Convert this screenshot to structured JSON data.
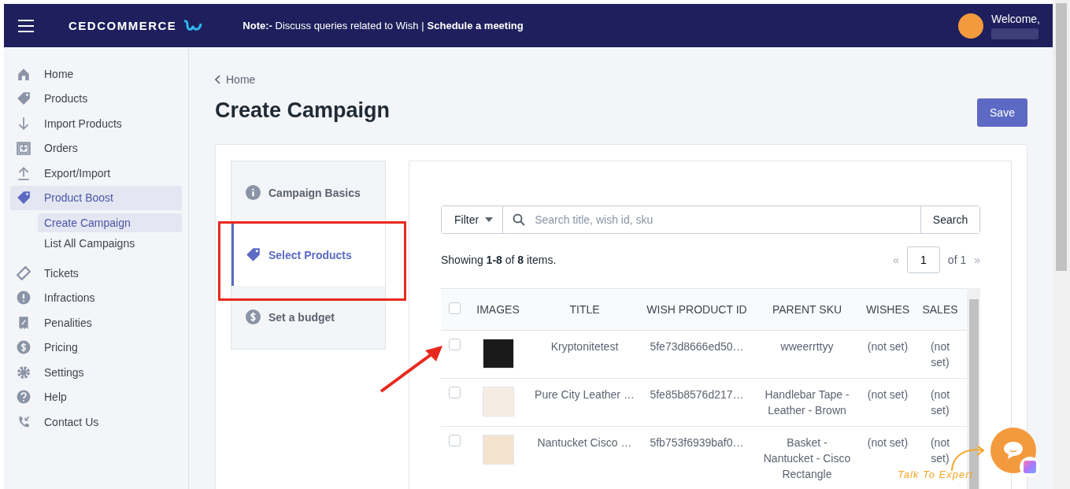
{
  "header": {
    "brand": "CEDCOMMERCE",
    "note_label": "Note:-",
    "note_text": "Discuss queries related to Wish |",
    "note_link": "Schedule a meeting",
    "welcome": "Welcome,"
  },
  "sidebar": {
    "items": [
      {
        "label": "Home",
        "selected": false
      },
      {
        "label": "Products",
        "selected": false
      },
      {
        "label": "Import Products",
        "selected": false
      },
      {
        "label": "Orders",
        "selected": false
      },
      {
        "label": "Export/Import",
        "selected": false
      },
      {
        "label": "Product Boost",
        "selected": true,
        "children": [
          {
            "label": "Create Campaign",
            "selected": true
          },
          {
            "label": "List All Campaigns",
            "selected": false
          }
        ]
      },
      {
        "label": "Tickets",
        "selected": false
      },
      {
        "label": "Infractions",
        "selected": false
      },
      {
        "label": "Penalities",
        "selected": false
      },
      {
        "label": "Pricing",
        "selected": false
      },
      {
        "label": "Settings",
        "selected": false
      },
      {
        "label": "Help",
        "selected": false
      },
      {
        "label": "Contact Us",
        "selected": false
      }
    ]
  },
  "breadcrumb": "Home",
  "title": "Create Campaign",
  "save_button": "Save",
  "steps": [
    {
      "label": "Campaign Basics",
      "selected": false
    },
    {
      "label": "Select Products",
      "selected": true
    },
    {
      "label": "Set a budget",
      "selected": false
    }
  ],
  "filter": {
    "button": "Filter",
    "placeholder": "Search title, wish id, sku",
    "search_button": "Search"
  },
  "summary": "Showing **1-8** of **8** items.",
  "pagination": {
    "prev": "«",
    "page": "1",
    "of": "of 1",
    "next": "»"
  },
  "table": {
    "header_checked": false,
    "columns": [
      "IMAGES",
      "TITLE",
      "WISH PRODUCT ID",
      "PARENT SKU",
      "WISHES",
      "SALES"
    ],
    "rows": [
      {
        "checked": false,
        "title": "Kryptonitetest",
        "wish_id": "5fe73d8666ed50…",
        "parent_sku": "wweerrttyy",
        "wishes": "(not set)",
        "sales": "(not set)"
      },
      {
        "checked": false,
        "title": "Pure City Leather …",
        "wish_id": "5fe85b8576d217…",
        "parent_sku": "Handlebar Tape - Leather - Brown",
        "wishes": "(not set)",
        "sales": "(not set)"
      },
      {
        "checked": false,
        "title": "Nantucket Cisco …",
        "wish_id": "5fb753f6939baf0…",
        "parent_sku": "Basket - Nantucket - Cisco Rectangle",
        "wishes": "(not set)",
        "sales": "(not set)"
      }
    ]
  },
  "chat": {
    "caption": "Talk To Expert"
  }
}
